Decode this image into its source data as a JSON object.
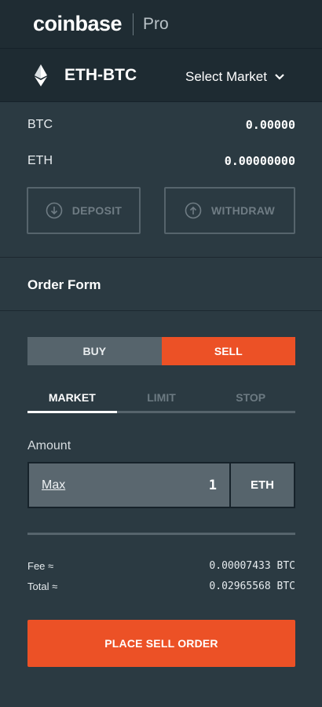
{
  "header": {
    "brand": "coinbase",
    "product": "Pro"
  },
  "market": {
    "pair": "ETH-BTC",
    "select_label": "Select Market"
  },
  "balances": [
    {
      "currency": "BTC",
      "value": "0.00000"
    },
    {
      "currency": "ETH",
      "value": "0.00000000"
    }
  ],
  "actions": {
    "deposit": "DEPOSIT",
    "withdraw": "WITHDRAW"
  },
  "order_form": {
    "title": "Order Form",
    "sides": {
      "buy": "BUY",
      "sell": "SELL",
      "selected": "SELL"
    },
    "types": [
      "MARKET",
      "LIMIT",
      "STOP"
    ],
    "selected_type": "MARKET",
    "amount_label": "Amount",
    "max_label": "Max",
    "amount_value": "1",
    "amount_unit": "ETH",
    "fee": {
      "label": "Fee ≈",
      "value": "0.00007433 BTC"
    },
    "total": {
      "label": "Total ≈",
      "value": "0.02965568 BTC"
    },
    "submit_label": "PLACE SELL ORDER"
  },
  "colors": {
    "accent": "#ec5126",
    "background": "#2b3a42",
    "header": "#1f2c33"
  }
}
